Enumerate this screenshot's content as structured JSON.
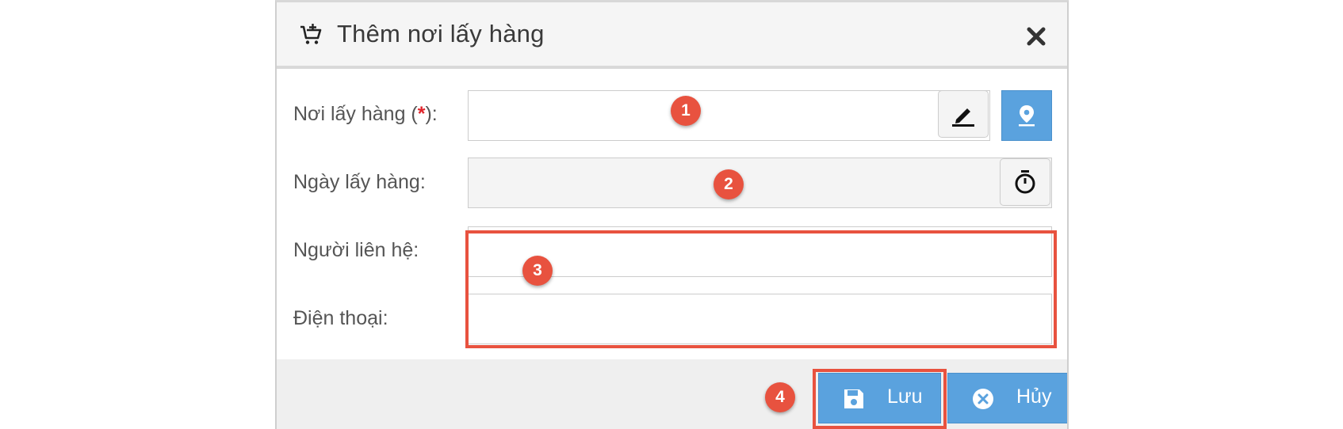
{
  "dialog": {
    "title": "Thêm nơi lấy hàng",
    "header_icon": "cart-plus-icon",
    "close_icon": "close-icon"
  },
  "form": {
    "pickup_place": {
      "label": "Nơi lấy hàng (",
      "required_mark": "*",
      "label_suffix": "):",
      "value": ""
    },
    "pickup_date": {
      "label": "Ngày lấy hàng:",
      "value": ""
    },
    "contact_person": {
      "label": "Người liên hệ:",
      "value": ""
    },
    "phone": {
      "label": "Điện thoại:",
      "value": ""
    }
  },
  "buttons": {
    "save": "Lưu",
    "cancel": "Hủy"
  },
  "annotations": {
    "badge1": "1",
    "badge2": "2",
    "badge3": "3",
    "badge4": "4"
  },
  "colors": {
    "primary_button": "#5aa2de",
    "annotation": "#e8523f",
    "required": "#e0242b"
  }
}
